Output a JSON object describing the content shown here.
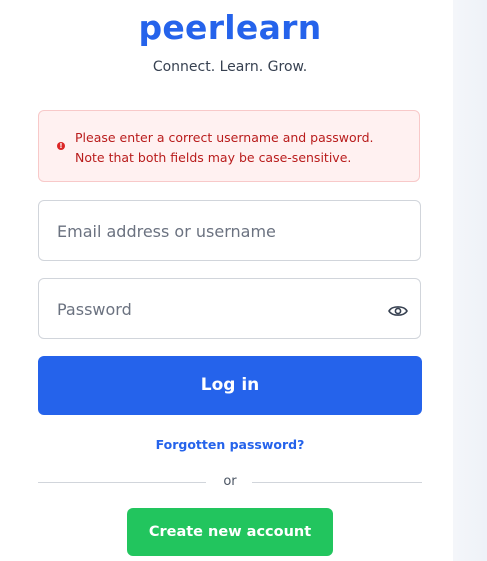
{
  "brand": {
    "name": "peerlearn",
    "tagline": "Connect. Learn. Grow.",
    "color": "#2563eb"
  },
  "alert": {
    "icon": "error-circle-icon",
    "message": "Please enter a correct username and password. Note that both fields may be case-sensitive.",
    "color": "#b91c1c",
    "background": "#fff1f1"
  },
  "form": {
    "email_placeholder": "Email address or username",
    "password_placeholder": "Password",
    "password_toggle_icon": "eye-icon",
    "login_label": "Log in",
    "forgot_label": "Forgotten password?",
    "divider_text": "or",
    "create_label": "Create new account"
  },
  "colors": {
    "primary": "#2563eb",
    "success": "#22c55e"
  }
}
